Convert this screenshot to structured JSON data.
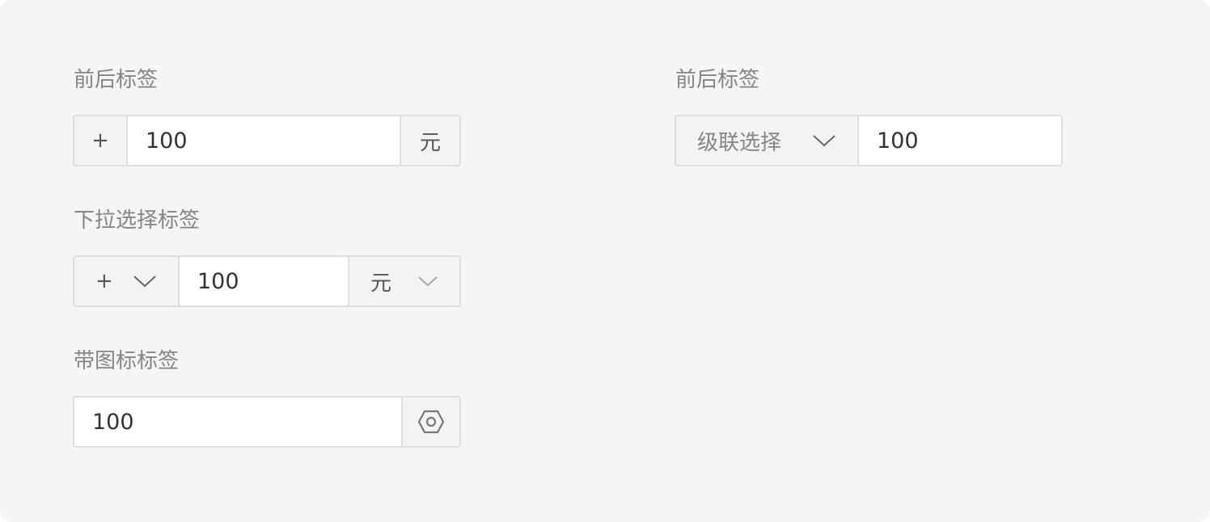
{
  "sections": {
    "prefix_suffix": {
      "label": "前后标签",
      "prefix": "+",
      "value": "100",
      "suffix": "元"
    },
    "dropdown_addon": {
      "label": "下拉选择标签",
      "prefix_select": "+",
      "value": "100",
      "suffix_select": "元"
    },
    "icon_addon": {
      "label": "带图标标签",
      "value": "100",
      "icon": "settings-hexagon-icon"
    },
    "cascader_addon": {
      "label": "前后标签",
      "cascader_text": "级联选择",
      "value": "100"
    }
  }
}
